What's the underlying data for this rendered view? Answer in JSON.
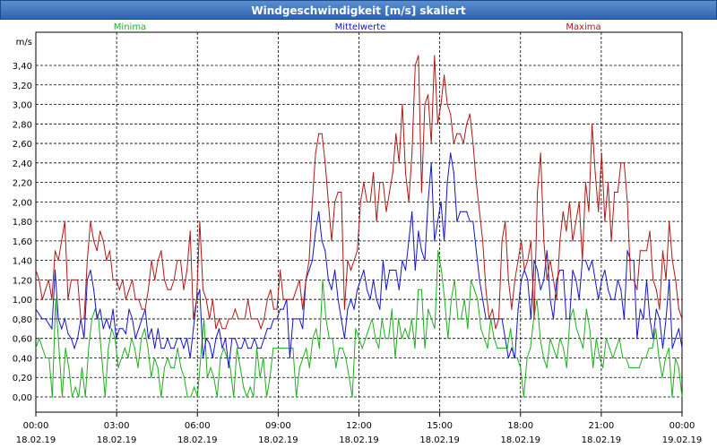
{
  "window": {
    "title": "Windgeschwindigkeit [m/s] skaliert"
  },
  "chart_data": {
    "type": "line",
    "title": "Windgeschwindigkeit [m/s] skaliert",
    "ylabel": "m/s",
    "ylim": [
      0,
      3.5
    ],
    "grid": true,
    "legend": [
      "Minima",
      "Mittelwerte",
      "Maxima"
    ],
    "y_ticks": [
      "0,00",
      "0,20",
      "0,40",
      "0,60",
      "0,80",
      "1,00",
      "1,20",
      "1,40",
      "1,60",
      "1,80",
      "2,00",
      "2,20",
      "2,40",
      "2,60",
      "2,80",
      "3,00",
      "3,20",
      "3,40"
    ],
    "x_ticks": [
      {
        "time": "00:00",
        "date": "18.02.19"
      },
      {
        "time": "03:00",
        "date": "18.02.19"
      },
      {
        "time": "06:00",
        "date": "18.02.19"
      },
      {
        "time": "09:00",
        "date": "18.02.19"
      },
      {
        "time": "12:00",
        "date": "18.02.19"
      },
      {
        "time": "15:00",
        "date": "18.02.19"
      },
      {
        "time": "18:00",
        "date": "18.02.19"
      },
      {
        "time": "21:00",
        "date": "18.02.19"
      },
      {
        "time": "00:00",
        "date": "19.02.19"
      }
    ],
    "x_hours_range": [
      0,
      24
    ],
    "series": [
      {
        "name": "Minima",
        "color": "#1fae1f",
        "values": [
          0.5,
          0.6,
          0.5,
          0.4,
          0.4,
          0.0,
          1.0,
          0.5,
          0.0,
          0.5,
          0.3,
          0.0,
          0.1,
          0.0,
          0.3,
          0.0,
          0.5,
          0.8,
          0.9,
          0.8,
          0.4,
          0.0,
          0.5,
          0.7,
          0.6,
          0.3,
          0.4,
          0.5,
          0.4,
          0.6,
          0.5,
          0.3,
          0.6,
          0.7,
          0.5,
          0.2,
          0.4,
          0.3,
          0.0,
          0.3,
          0.4,
          0.3,
          0.3,
          0.5,
          0.3,
          0.2,
          0.0,
          0.0,
          0.1,
          0.0,
          0.4,
          0.8,
          0.2,
          0.3,
          0.2,
          0.0,
          0.4,
          0.5,
          0.4,
          0.3,
          0.0,
          0.5,
          0.3,
          0.1,
          0.0,
          0.1,
          0.0,
          0.5,
          0.2,
          0.4,
          0.0,
          0.2,
          0.5,
          0.5,
          0.5,
          0.5,
          0.5,
          0.5,
          0.5,
          0.0,
          0.3,
          0.4,
          0.5,
          0.3,
          0.6,
          0.7,
          0.5,
          1.2,
          0.8,
          0.6,
          0.6,
          0.3,
          0.5,
          0.5,
          0.4,
          0.2,
          0.0,
          0.7,
          0.6,
          0.5,
          0.6,
          0.7,
          0.8,
          0.6,
          0.5,
          0.8,
          0.6,
          0.6,
          0.9,
          0.4,
          0.8,
          0.6,
          0.7,
          0.6,
          0.8,
          0.5,
          1.1,
          1.1,
          0.5,
          0.9,
          0.8,
          0.7,
          1.5,
          1.3,
          1.0,
          0.6,
          1.0,
          1.2,
          0.8,
          0.8,
          1.0,
          0.7,
          1.2,
          1.1,
          1.0,
          0.7,
          0.6,
          0.5,
          0.8,
          0.6,
          0.5,
          0.5,
          0.5,
          0.5,
          0.7,
          0.4,
          0.4,
          0.3,
          0.0,
          0.4,
          0.5,
          0.8,
          1.0,
          0.6,
          0.4,
          0.3,
          0.6,
          0.5,
          0.4,
          0.6,
          0.5,
          0.3,
          0.8,
          0.9,
          0.7,
          0.6,
          0.5,
          0.9,
          0.7,
          0.3,
          0.6,
          0.4,
          0.3,
          0.6,
          0.5,
          0.4,
          0.5,
          0.6,
          0.4,
          0.4,
          0.3,
          0.3,
          0.3,
          0.3,
          0.4,
          0.4,
          0.5,
          0.5,
          0.7,
          0.4,
          0.2,
          0.4,
          0.5,
          0.0,
          0.4,
          0.3,
          0.0
        ]
      },
      {
        "name": "Mittelwerte",
        "color": "#1414c8",
        "values": [
          0.9,
          0.85,
          0.8,
          0.8,
          0.75,
          0.7,
          1.3,
          0.8,
          0.7,
          0.8,
          0.65,
          0.6,
          0.5,
          0.6,
          0.8,
          0.6,
          1.2,
          1.3,
          1.1,
          0.8,
          0.9,
          0.7,
          0.8,
          0.7,
          0.9,
          0.6,
          0.7,
          0.7,
          0.65,
          0.9,
          0.8,
          0.6,
          0.7,
          0.8,
          0.9,
          0.6,
          0.7,
          0.5,
          0.7,
          0.5,
          0.5,
          0.6,
          0.5,
          0.5,
          0.6,
          0.6,
          0.5,
          0.6,
          0.4,
          0.7,
          1.0,
          1.1,
          0.4,
          0.6,
          0.55,
          0.4,
          0.6,
          0.7,
          0.5,
          0.6,
          0.3,
          0.6,
          0.6,
          0.5,
          0.5,
          0.6,
          0.5,
          0.5,
          0.6,
          0.5,
          0.5,
          0.6,
          0.7,
          0.7,
          0.8,
          0.8,
          0.9,
          0.9,
          1.0,
          0.4,
          0.8,
          0.8,
          0.8,
          0.7,
          1.2,
          1.3,
          1.4,
          1.7,
          1.9,
          1.6,
          1.5,
          1.2,
          1.1,
          1.3,
          1.0,
          0.8,
          0.6,
          0.9,
          1.0,
          0.9,
          1.1,
          1.2,
          1.3,
          1.1,
          1.0,
          1.2,
          1.0,
          0.9,
          1.4,
          1.1,
          1.3,
          1.3,
          1.3,
          1.1,
          1.4,
          1.3,
          1.6,
          1.9,
          1.3,
          1.7,
          1.5,
          1.4,
          2.0,
          2.4,
          1.6,
          1.8,
          2.0,
          1.6,
          2.2,
          2.5,
          2.3,
          1.8,
          1.9,
          1.9,
          1.9,
          1.8,
          1.8,
          1.5,
          1.2,
          1.0,
          0.8,
          0.8,
          0.8,
          0.8,
          0.8,
          0.8,
          0.6,
          0.4,
          0.5,
          0.4,
          0.9,
          1.2,
          1.3,
          1.2,
          0.8,
          1.4,
          1.3,
          1.1,
          1.2,
          1.5,
          1.0,
          0.8,
          1.2,
          1.3,
          1.3,
          0.8,
          0.8,
          1.3,
          1.2,
          1.0,
          1.4,
          1.4,
          1.3,
          1.4,
          1.2,
          1.0,
          1.2,
          1.3,
          1.1,
          1.0,
          1.0,
          1.2,
          1.1,
          0.8,
          1.5,
          1.4,
          1.4,
          0.6,
          0.9,
          0.8,
          1.2,
          0.8,
          0.6,
          0.9,
          0.8,
          0.5,
          0.8,
          1.2,
          0.5,
          0.6,
          0.7,
          0.5
        ]
      },
      {
        "name": "Maxima",
        "color": "#b01818",
        "values": [
          1.3,
          1.2,
          1.0,
          1.1,
          1.2,
          1.0,
          1.5,
          1.4,
          1.6,
          1.8,
          1.0,
          1.2,
          1.2,
          1.2,
          0.8,
          0.8,
          1.4,
          1.8,
          1.6,
          1.5,
          1.7,
          1.6,
          1.4,
          1.5,
          1.2,
          1.2,
          1.1,
          1.2,
          1.0,
          1.1,
          1.2,
          1.0,
          1.0,
          0.9,
          0.9,
          1.1,
          1.4,
          1.2,
          1.4,
          1.5,
          1.2,
          1.1,
          1.1,
          1.2,
          1.4,
          1.4,
          1.1,
          1.3,
          1.7,
          0.8,
          1.0,
          1.8,
          1.1,
          1.0,
          0.8,
          1.0,
          0.7,
          0.8,
          0.7,
          0.7,
          0.8,
          0.8,
          0.9,
          0.8,
          0.8,
          0.8,
          1.0,
          0.8,
          0.8,
          0.8,
          0.7,
          0.8,
          1.0,
          1.1,
          0.9,
          0.9,
          1.3,
          1.0,
          1.0,
          1.0,
          1.0,
          1.1,
          1.2,
          0.9,
          1.2,
          1.4,
          2.0,
          2.5,
          2.7,
          2.7,
          2.4,
          2.0,
          1.6,
          2.0,
          2.1,
          2.1,
          0.9,
          1.4,
          1.3,
          1.4,
          1.5,
          2.0,
          2.2,
          2.0,
          2.0,
          2.3,
          1.8,
          2.2,
          2.2,
          1.9,
          2.1,
          2.3,
          2.7,
          2.4,
          3.0,
          2.3,
          2.0,
          2.5,
          3.4,
          3.5,
          2.1,
          3.0,
          3.1,
          2.6,
          3.5,
          2.8,
          3.0,
          3.3,
          3.0,
          2.9,
          2.6,
          2.7,
          2.7,
          2.6,
          2.8,
          2.9,
          2.6,
          2.2,
          1.9,
          1.6,
          1.1,
          0.8,
          0.9,
          0.7,
          0.8,
          1.6,
          1.8,
          1.2,
          0.9,
          1.2,
          1.4,
          1.6,
          1.3,
          1.4,
          1.6,
          0.8,
          2.1,
          2.5,
          1.6,
          1.2,
          1.4,
          1.2,
          1.0,
          1.6,
          1.9,
          1.7,
          2.0,
          1.6,
          1.8,
          2.0,
          1.4,
          2.2,
          1.9,
          2.8,
          2.3,
          1.9,
          2.5,
          1.8,
          2.2,
          1.6,
          2.1,
          2.1,
          2.4,
          2.4,
          2.0,
          1.2,
          1.2,
          1.1,
          1.5,
          1.5,
          1.5,
          1.7,
          1.2,
          1.1,
          0.9,
          1.5,
          1.2,
          1.8,
          1.4,
          1.2,
          0.9,
          0.8
        ]
      }
    ]
  }
}
